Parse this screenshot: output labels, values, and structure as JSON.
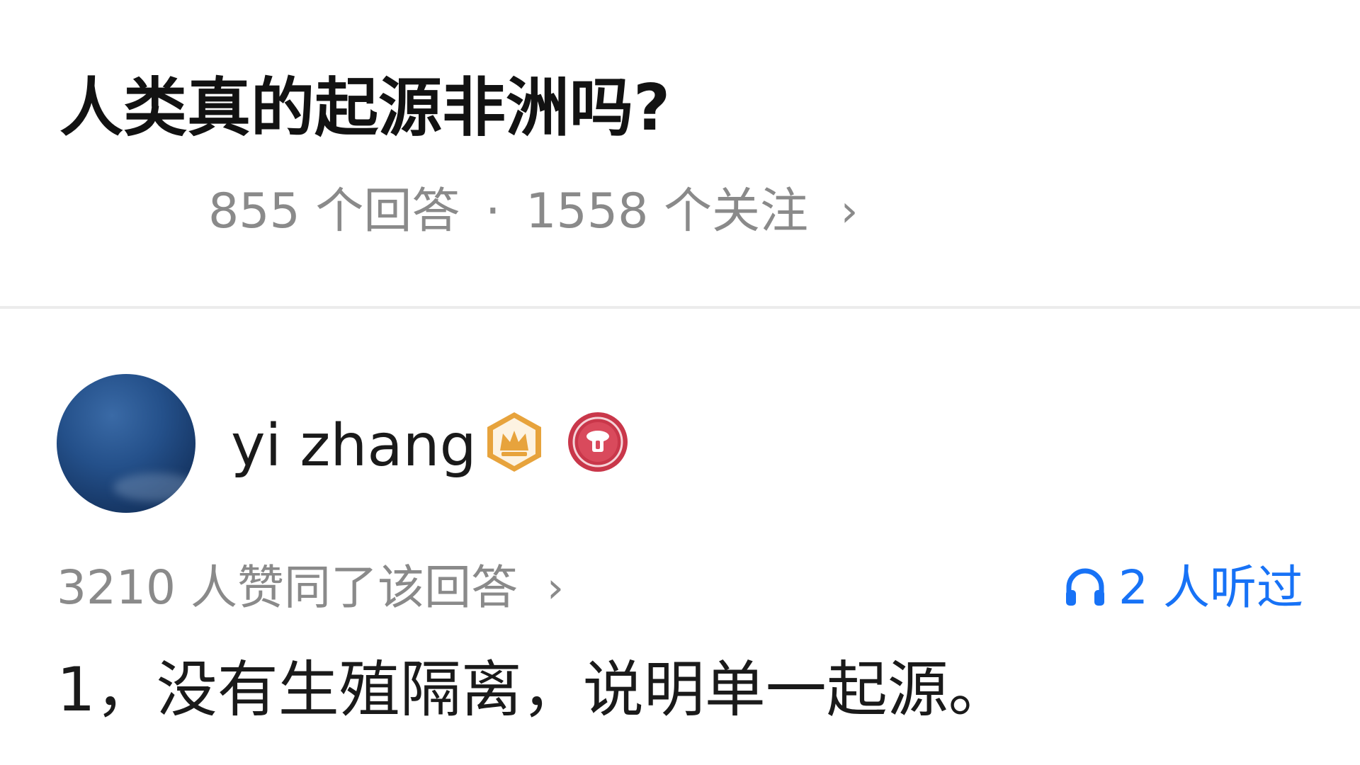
{
  "question": {
    "title": "人类真的起源非洲吗?",
    "answer_count": "855 个回答",
    "separator": "·",
    "follower_count": "1558 个关注",
    "chevron_icon": "chevron-right-icon"
  },
  "answer": {
    "author": {
      "name": "yi zhang",
      "avatar_icon": "avatar-night-sky",
      "badges": [
        "crown-badge-icon",
        "medal-badge-icon"
      ]
    },
    "vote_text": "3210 人赞同了该回答",
    "listen": {
      "icon": "headphone-icon",
      "text": "2 人听过"
    },
    "body": "1，没有生殖隔离，说明单一起源。"
  },
  "colors": {
    "meta_gray": "#8a8a8a",
    "link_blue": "#1772f6",
    "badge_gold": "#e7a33c",
    "badge_red": "#c9374a",
    "divider": "#ececec"
  }
}
